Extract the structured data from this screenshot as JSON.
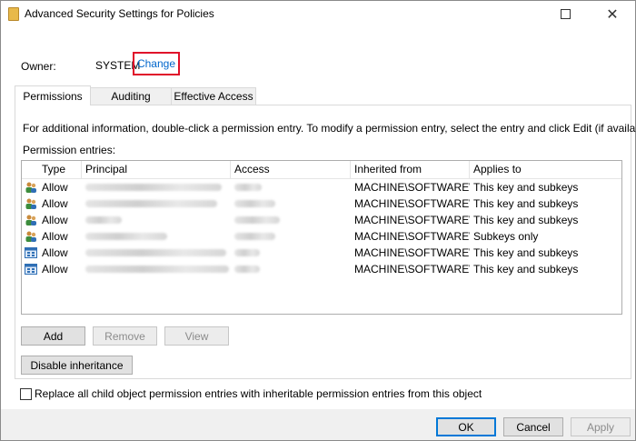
{
  "window": {
    "title": "Advanced Security Settings for Policies"
  },
  "owner": {
    "label": "Owner:",
    "value": "SYSTEM",
    "change_link": "Change"
  },
  "tabs": [
    {
      "label": "Permissions",
      "active": true
    },
    {
      "label": "Auditing",
      "active": false
    },
    {
      "label": "Effective Access",
      "active": false
    }
  ],
  "permissions": {
    "info_text": "For additional information, double-click a permission entry. To modify a permission entry, select the entry and click Edit (if available).",
    "entries_label": "Permission entries:",
    "columns": [
      "Type",
      "Principal",
      "Access",
      "Inherited from",
      "Applies to"
    ],
    "rows": [
      {
        "icon": "user-group-icon",
        "type": "Allow",
        "inherited_from": "MACHINE\\SOFTWARE\\...",
        "applies_to": "This key and subkeys"
      },
      {
        "icon": "user-group-icon",
        "type": "Allow",
        "inherited_from": "MACHINE\\SOFTWARE\\...",
        "applies_to": "This key and subkeys"
      },
      {
        "icon": "user-group-icon",
        "type": "Allow",
        "inherited_from": "MACHINE\\SOFTWARE\\...",
        "applies_to": "This key and subkeys"
      },
      {
        "icon": "user-group-icon",
        "type": "Allow",
        "inherited_from": "MACHINE\\SOFTWARE\\...",
        "applies_to": "Subkeys only"
      },
      {
        "icon": "app-package-icon",
        "type": "Allow",
        "inherited_from": "MACHINE\\SOFTWARE\\...",
        "applies_to": "This key and subkeys"
      },
      {
        "icon": "app-package-icon",
        "type": "Allow",
        "inherited_from": "MACHINE\\SOFTWARE\\...",
        "applies_to": "This key and subkeys"
      }
    ]
  },
  "buttons": {
    "add": "Add",
    "remove": "Remove",
    "view": "View",
    "disable_inheritance": "Disable inheritance",
    "ok": "OK",
    "cancel": "Cancel",
    "apply": "Apply"
  },
  "replace_checkbox": {
    "label": "Replace all child object permission entries with inheritable permission entries from this object",
    "checked": false
  },
  "colors": {
    "link": "#0066cc",
    "highlight_border": "#e0102a",
    "default_button_border": "#0078d7"
  }
}
